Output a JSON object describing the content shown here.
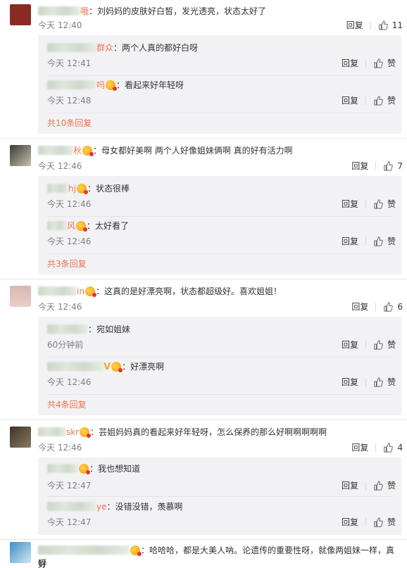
{
  "labels": {
    "reply": "回复",
    "praise": "赞"
  },
  "threads": [
    {
      "name_suffix": "哦",
      "text": "刘妈妈的皮肤好白皙，发光透亮，状态太好了",
      "time": "今天 12:40",
      "likes": "11",
      "avatar_color": "#8b2b22",
      "replies": [
        {
          "name_suffix": "群众",
          "vip": false,
          "text": "两个人真的都好白呀",
          "time": "今天 12:41"
        },
        {
          "name_suffix": "吗",
          "vip": true,
          "text": "看起来好年轻呀",
          "time": "今天 12:48"
        }
      ],
      "more": "共10条回复"
    },
    {
      "name_suffix": "秋",
      "text": "母女都好美啊  两个人好像姐妹俩啊 真的好有活力啊",
      "time": "今天 12:46",
      "likes": "7",
      "avatar_color": "#6d6a62",
      "replies": [
        {
          "name_suffix": "hj",
          "vip": true,
          "text": "状态很棒",
          "time": "今天 12:46"
        },
        {
          "name_suffix": "风",
          "vip": true,
          "text": "太好看了",
          "time": "今天 12:46"
        }
      ],
      "more": "共3条回复"
    },
    {
      "name_suffix": "in",
      "text": "这真的是好漂亮啊，状态都超级好。喜欢姐姐！",
      "time": "今天 12:46",
      "likes": "6",
      "avatar_color": "#d9b7b0",
      "replies": [
        {
          "name_suffix": "",
          "vip": false,
          "text": "宛如姐妹",
          "time": "60分钟前"
        },
        {
          "name_suffix": "V",
          "vip": true,
          "text": "好漂亮啊",
          "time": "今天 12:46"
        }
      ],
      "more": "共4条回复"
    },
    {
      "name_suffix": "skr",
      "text": "芸姐妈妈真的看起来好年轻呀，怎么保养的那么好啊啊啊啊啊",
      "time": "今天 12:46",
      "likes": "4",
      "avatar_color": "#5c5040",
      "replies": [
        {
          "name_suffix": "",
          "vip": true,
          "text": "我也想知道",
          "time": "今天 12:47"
        },
        {
          "name_suffix": "ye",
          "vip": false,
          "text": "没错没错，羡慕啊",
          "time": "今天 12:47"
        }
      ],
      "more": ""
    },
    {
      "name_suffix": "",
      "text": "哈哈哈，都是大美人呐。论遗传的重要性呀，就像两姐妹一样，真好",
      "text_wrap": "呀",
      "time": "",
      "likes": "",
      "avatar_color": "#6ab0d8",
      "replies": [],
      "more": ""
    }
  ]
}
